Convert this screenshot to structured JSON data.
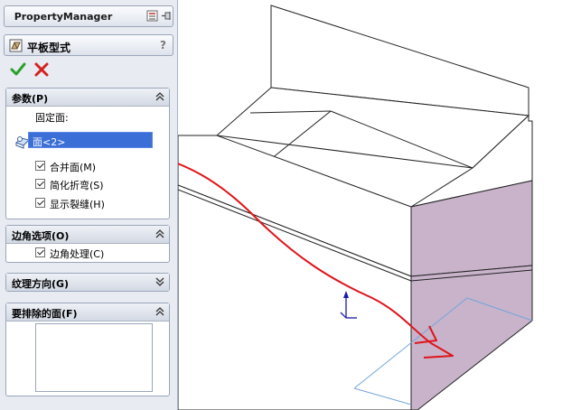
{
  "property_manager": {
    "title": "PropertyManager"
  },
  "feature": {
    "title": "平板型式",
    "help": "?"
  },
  "actions": {
    "ok_icon": "checkmark-icon",
    "cancel_icon": "x-icon"
  },
  "params": {
    "header": "参数(P)",
    "fixed_face_label": "固定面:",
    "fixed_face_value": "面<2>",
    "merge_faces": "合并面(M)",
    "simplify_bends": "简化折弯(S)",
    "show_slit": "显示裂缝(H)"
  },
  "corner": {
    "header": "边角选项(O)",
    "corner_treatment": "边角处理(C)"
  },
  "grain": {
    "header": "纹理方向(G)"
  },
  "exclude": {
    "header": "要排除的面(F)"
  },
  "colors": {
    "panel_bg": "#e8ebf1",
    "selection_blue": "#3b6ed6",
    "highlight_face": "#c8b3cb",
    "annotation_red": "#e0141a",
    "ok_green": "#2aa02a",
    "cancel_red": "#d42020"
  }
}
